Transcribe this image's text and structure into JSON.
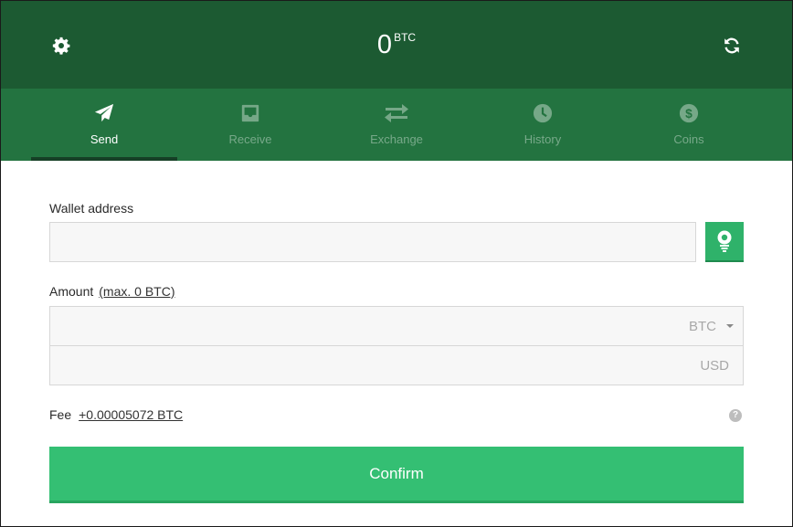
{
  "header": {
    "balance_value": "0",
    "balance_unit": "BTC",
    "settings_icon": "gear-icon",
    "refresh_icon": "refresh-icon"
  },
  "tabs": [
    {
      "label": "Send",
      "icon": "paper-plane-icon",
      "active": true
    },
    {
      "label": "Receive",
      "icon": "inbox-icon",
      "active": false
    },
    {
      "label": "Exchange",
      "icon": "exchange-arrows-icon",
      "active": false
    },
    {
      "label": "History",
      "icon": "clock-icon",
      "active": false
    },
    {
      "label": "Coins",
      "icon": "dollar-coin-icon",
      "active": false
    }
  ],
  "form": {
    "wallet_label": "Wallet address",
    "wallet_value": "",
    "qr_icon": "qr-scan-icon",
    "amount_label": "Amount",
    "amount_max_link": "(max. 0 BTC)",
    "amount_value": "",
    "amount_currency": "BTC",
    "usd_value": "",
    "usd_currency": "USD",
    "fee_label": "Fee",
    "fee_value": "+0.00005072 BTC",
    "help_icon": "question-icon",
    "confirm_label": "Confirm"
  },
  "colors": {
    "header_bg": "#1c5a32",
    "nav_bg": "#237340",
    "accent": "#34bf73"
  }
}
